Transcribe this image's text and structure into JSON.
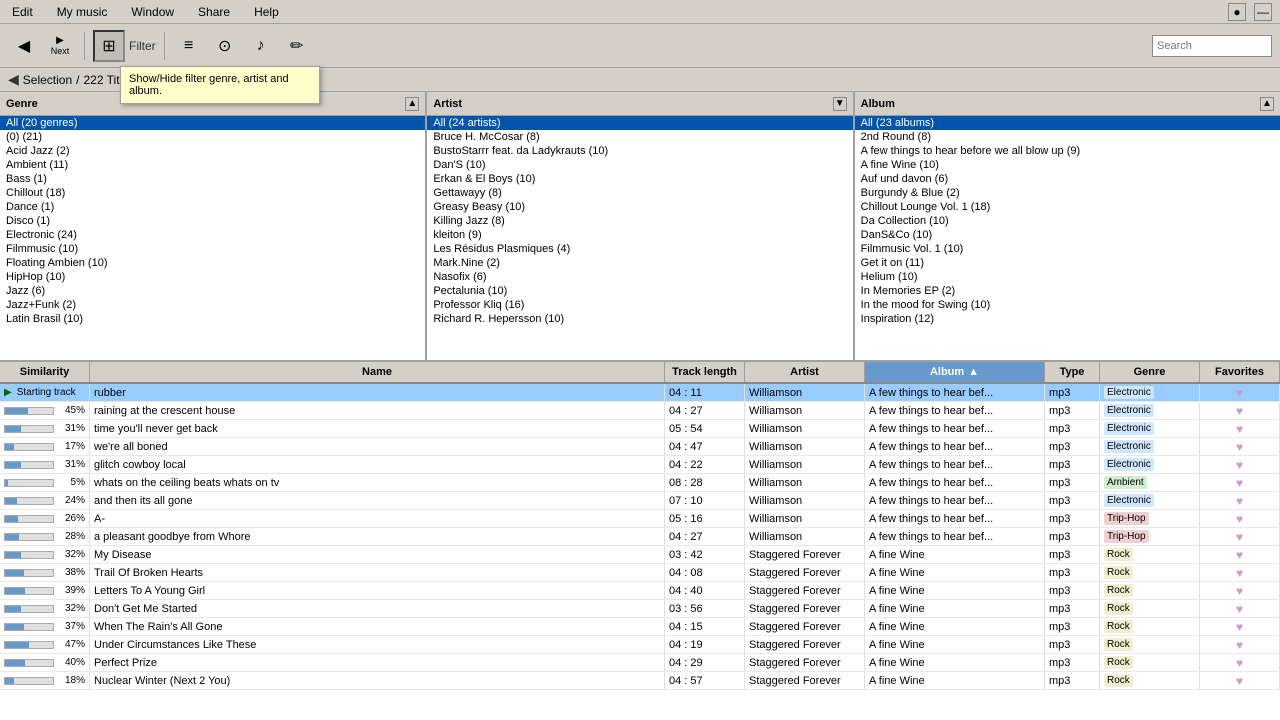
{
  "menubar": {
    "items": [
      "Edit",
      "My music",
      "Window",
      "Share",
      "Help"
    ]
  },
  "toolbar": {
    "back_label": "Back",
    "next_label": "Next",
    "filter_label": "Filter",
    "search_placeholder": "Search",
    "tooltip_text": "Show/Hide filter genre, artist and album."
  },
  "breadcrumb": {
    "selection_text": "Selection",
    "count_text": "222 Title",
    "separator": "/"
  },
  "filter": {
    "genre_header": "Genre",
    "artist_header": "Artist",
    "album_header": "Album",
    "genres": [
      "All (20 genres)",
      "(0)  (21)",
      "Acid Jazz  (2)",
      "Ambient  (11)",
      "Bass  (1)",
      "Chillout  (18)",
      "Dance  (1)",
      "Disco  (1)",
      "Electronic  (24)",
      "Filmmusic  (10)",
      "Floating Ambien  (10)",
      "HipHop  (10)",
      "Jazz  (6)",
      "Jazz+Funk  (2)",
      "Latin Brasil  (10)"
    ],
    "artists": [
      "All (24 artists)",
      "Bruce H. McCosar  (8)",
      "BustoStarrr feat. da Ladykrauts  (10)",
      "Dan'S  (10)",
      "Erkan & El Boys  (10)",
      "Gettawayy  (8)",
      "Greasy Beasy  (10)",
      "Killing Jazz  (8)",
      "kleiton  (9)",
      "Les Résidus Plasmiques  (4)",
      "Mark.Nine  (2)",
      "Nasofix  (6)",
      "Pectalunia  (10)",
      "Professor Kliq  (16)",
      "Richard R. Hepersson  (10)"
    ],
    "albums": [
      "All (23 albums)",
      "2nd Round  (8)",
      "A few things to hear before we all blow up  (9)",
      "A fine Wine  (10)",
      "Auf und davon  (6)",
      "Burgundy & Blue  (2)",
      "Chillout Lounge Vol. 1  (18)",
      "Da Collection  (10)",
      "DanS&Co  (10)",
      "Filmmusic Vol. 1  (10)",
      "Get it on  (11)",
      "Helium  (10)",
      "In Memories EP  (2)",
      "In the mood for Swing  (10)",
      "Inspiration  (12)"
    ]
  },
  "table": {
    "headers": {
      "similarity": "Similarity",
      "name": "Name",
      "tracklength": "Track length",
      "artist": "Artist",
      "album": "Album",
      "type": "Type",
      "genre": "Genre",
      "favorites": "Favorites"
    },
    "rows": [
      {
        "similarity": "Starting track",
        "name": "rubber",
        "tracklength": "04 : 11",
        "artist": "Williamson",
        "album": "A few things to hear bef...",
        "type": "mp3",
        "genre": "Electronic",
        "favorites": "♥",
        "is_playing": true,
        "sim_pct": 0,
        "sim_label": ""
      },
      {
        "similarity": "45%",
        "name": "raining at the crescent house",
        "tracklength": "04 : 27",
        "artist": "Williamson",
        "album": "A few things to hear bef...",
        "type": "mp3",
        "genre": "Electronic",
        "favorites": "♥",
        "is_playing": false,
        "sim_pct": 45,
        "sim_label": "45%"
      },
      {
        "similarity": "31%",
        "name": "time you'll never get back",
        "tracklength": "05 : 54",
        "artist": "Williamson",
        "album": "A few things to hear bef...",
        "type": "mp3",
        "genre": "Electronic",
        "favorites": "♥",
        "is_playing": false,
        "sim_pct": 31,
        "sim_label": "31%"
      },
      {
        "similarity": "17%",
        "name": "we're all boned",
        "tracklength": "04 : 47",
        "artist": "Williamson",
        "album": "A few things to hear bef...",
        "type": "mp3",
        "genre": "Electronic",
        "favorites": "♥",
        "is_playing": false,
        "sim_pct": 17,
        "sim_label": "17%"
      },
      {
        "similarity": "31%",
        "name": "glitch cowboy local",
        "tracklength": "04 : 22",
        "artist": "Williamson",
        "album": "A few things to hear bef...",
        "type": "mp3",
        "genre": "Electronic",
        "favorites": "♥",
        "is_playing": false,
        "sim_pct": 31,
        "sim_label": "31%"
      },
      {
        "similarity": "5%",
        "name": "whats on the ceiling beats whats on tv",
        "tracklength": "08 : 28",
        "artist": "Williamson",
        "album": "A few things to hear bef...",
        "type": "mp3",
        "genre": "Ambient",
        "favorites": "♥",
        "is_playing": false,
        "sim_pct": 5,
        "sim_label": "5%"
      },
      {
        "similarity": "24%",
        "name": "and then its all gone",
        "tracklength": "07 : 10",
        "artist": "Williamson",
        "album": "A few things to hear bef...",
        "type": "mp3",
        "genre": "Electronic",
        "favorites": "♥",
        "is_playing": false,
        "sim_pct": 24,
        "sim_label": "24%"
      },
      {
        "similarity": "26%",
        "name": "A-",
        "tracklength": "05 : 16",
        "artist": "Williamson",
        "album": "A few things to hear bef...",
        "type": "mp3",
        "genre": "Trip-Hop",
        "favorites": "♥",
        "is_playing": false,
        "sim_pct": 26,
        "sim_label": "26%"
      },
      {
        "similarity": "28%",
        "name": "a pleasant goodbye from Whore",
        "tracklength": "04 : 27",
        "artist": "Williamson",
        "album": "A few things to hear bef...",
        "type": "mp3",
        "genre": "Trip-Hop",
        "favorites": "♥",
        "is_playing": false,
        "sim_pct": 28,
        "sim_label": "28%"
      },
      {
        "similarity": "32%",
        "name": "My Disease",
        "tracklength": "03 : 42",
        "artist": "Staggered Forever",
        "album": "A fine Wine",
        "type": "mp3",
        "genre": "Rock",
        "favorites": "♥",
        "is_playing": false,
        "sim_pct": 32,
        "sim_label": "32%"
      },
      {
        "similarity": "38%",
        "name": "Trail Of Broken Hearts",
        "tracklength": "04 : 08",
        "artist": "Staggered Forever",
        "album": "A fine Wine",
        "type": "mp3",
        "genre": "Rock",
        "favorites": "♥",
        "is_playing": false,
        "sim_pct": 38,
        "sim_label": "38%"
      },
      {
        "similarity": "39%",
        "name": "Letters To A Young Girl",
        "tracklength": "04 : 40",
        "artist": "Staggered Forever",
        "album": "A fine Wine",
        "type": "mp3",
        "genre": "Rock",
        "favorites": "♥",
        "is_playing": false,
        "sim_pct": 39,
        "sim_label": "39%"
      },
      {
        "similarity": "32%",
        "name": "Don't Get Me Started",
        "tracklength": "03 : 56",
        "artist": "Staggered Forever",
        "album": "A fine Wine",
        "type": "mp3",
        "genre": "Rock",
        "favorites": "♥",
        "is_playing": false,
        "sim_pct": 32,
        "sim_label": "32%"
      },
      {
        "similarity": "37%",
        "name": "When The Rain's All Gone",
        "tracklength": "04 : 15",
        "artist": "Staggered Forever",
        "album": "A fine Wine",
        "type": "mp3",
        "genre": "Rock",
        "favorites": "♥",
        "is_playing": false,
        "sim_pct": 37,
        "sim_label": "37%"
      },
      {
        "similarity": "47%",
        "name": "Under Circumstances Like These",
        "tracklength": "04 : 19",
        "artist": "Staggered Forever",
        "album": "A fine Wine",
        "type": "mp3",
        "genre": "Rock",
        "favorites": "♥",
        "is_playing": false,
        "sim_pct": 47,
        "sim_label": "47%"
      },
      {
        "similarity": "40%",
        "name": "Perfect Prize",
        "tracklength": "04 : 29",
        "artist": "Staggered Forever",
        "album": "A fine Wine",
        "type": "mp3",
        "genre": "Rock",
        "favorites": "♥",
        "is_playing": false,
        "sim_pct": 40,
        "sim_label": "40%"
      },
      {
        "similarity": "18%",
        "name": "Nuclear Winter (Next 2 You)",
        "tracklength": "04 : 57",
        "artist": "Staggered Forever",
        "album": "A fine Wine",
        "type": "mp3",
        "genre": "Rock",
        "favorites": "♥",
        "is_playing": false,
        "sim_pct": 18,
        "sim_label": "18%"
      }
    ]
  }
}
